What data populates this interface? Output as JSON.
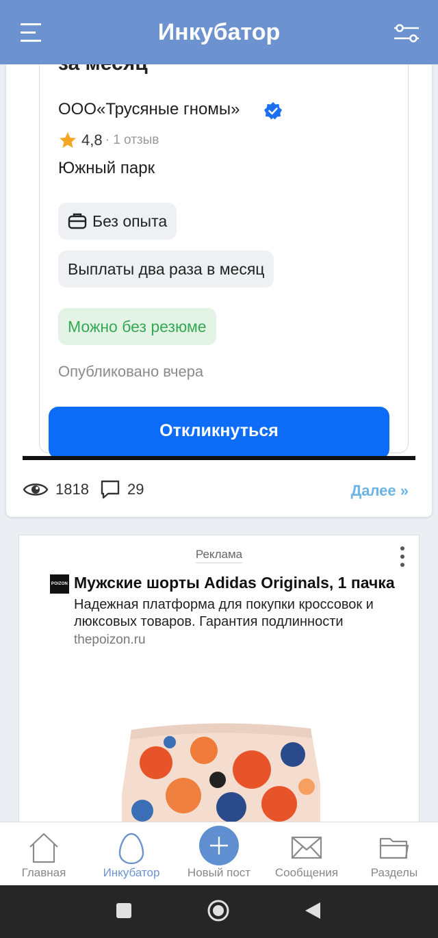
{
  "header": {
    "title": "Инкубатор"
  },
  "post": {
    "image_text": {
      "heading_fragment": "за месяц",
      "company": "ООО«Трусяные гномы»",
      "rating": "4,8",
      "reviews": "· 1 отзыв",
      "location": "Южный парк",
      "chip_experience": "Без опыта",
      "chip_payments": "Выплаты два раза в месяц",
      "chip_resume": "Можно без резюме",
      "published": "Опубликовано вчера",
      "apply_button": "Откликнуться"
    },
    "views": "1818",
    "comments": "29",
    "more_link": "Далее »"
  },
  "ad": {
    "label": "Реклама",
    "logo_text": "POIZON",
    "title": "Мужские шорты Adidas Originals, 1 пачка",
    "description": "Надежная платформа для покупки кроссовок и люксовых товаров. Гарантия подлинности",
    "domain": "thepoizon.ru"
  },
  "tabs": [
    {
      "label": "Главная",
      "icon": "home-icon",
      "active": false
    },
    {
      "label": "Инкубатор",
      "icon": "egg-icon",
      "active": true
    },
    {
      "label": "Новый пост",
      "icon": "plus-icon",
      "active": false
    },
    {
      "label": "Сообщения",
      "icon": "envelope-icon",
      "active": false
    },
    {
      "label": "Разделы",
      "icon": "folder-icon",
      "active": false
    }
  ],
  "colors": {
    "header": "#6c93cf",
    "accent_link": "#6cb4e4",
    "apply_button": "#0d6cf8",
    "resume_green": "#34a853"
  }
}
